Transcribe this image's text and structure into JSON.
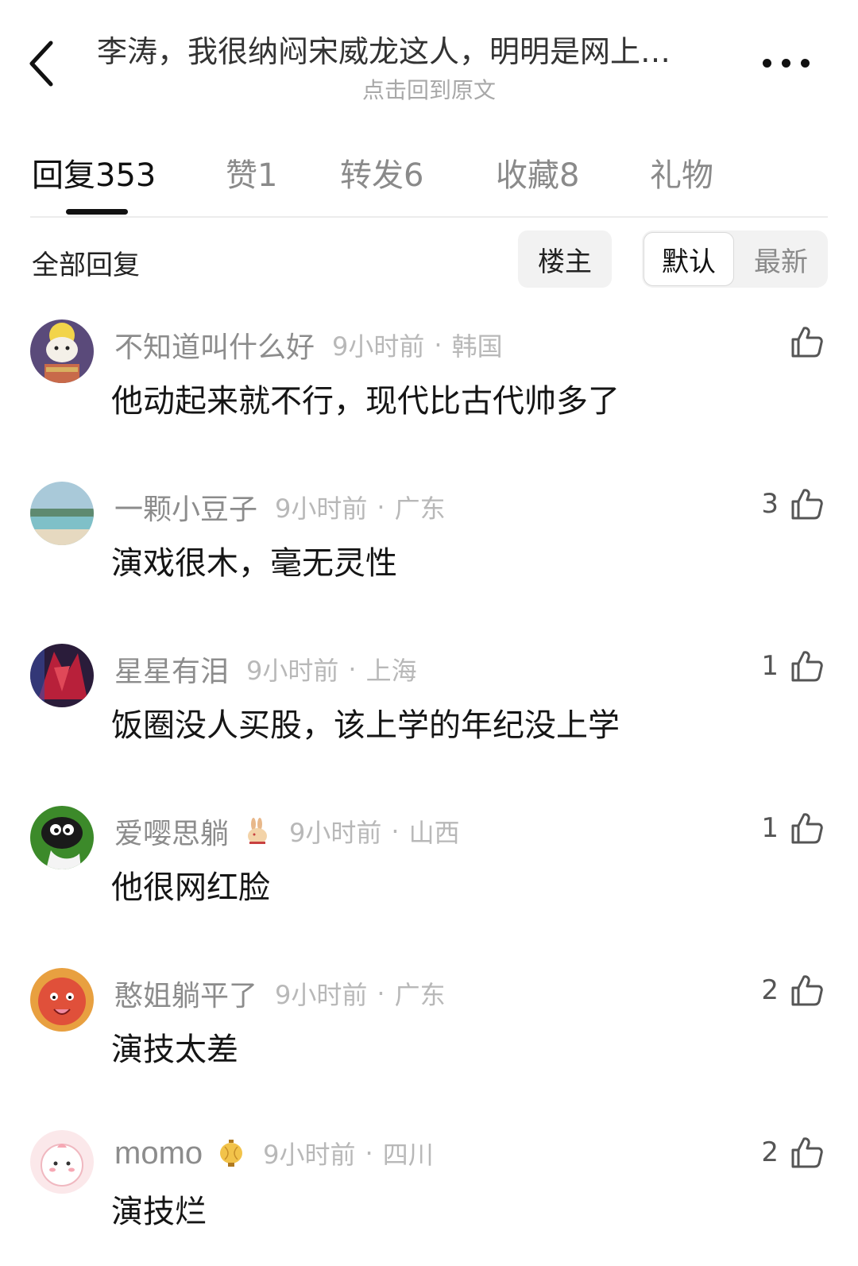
{
  "header": {
    "title": "李涛，我很纳闷宋威龙这人，明明是网上…",
    "subtitle": "点击回到原文",
    "icons": {
      "back": "chevron-left-icon",
      "more": "more-dots-icon"
    }
  },
  "tabs": [
    {
      "label": "回复353",
      "active": true
    },
    {
      "label": "赞1",
      "active": false
    },
    {
      "label": "转发6",
      "active": false
    },
    {
      "label": "收藏8",
      "active": false
    },
    {
      "label": "礼物",
      "active": false
    }
  ],
  "filter": {
    "all_label": "全部回复",
    "op_label": "楼主",
    "sort_default": "默认",
    "sort_latest": "最新",
    "sort_selected": "默认"
  },
  "comments": [
    {
      "user": "不知道叫什么好",
      "badge": "",
      "time": "9小时前",
      "location": "韩国",
      "text": "他动起来就不行，现代比古代帅多了",
      "likes": ""
    },
    {
      "user": "一颗小豆子",
      "badge": "",
      "time": "9小时前",
      "location": "广东",
      "text": "演戏很木，毫无灵性",
      "likes": "3"
    },
    {
      "user": "星星有泪",
      "badge": "",
      "time": "9小时前",
      "location": "上海",
      "text": "饭圈没人买股，该上学的年纪没上学",
      "likes": "1"
    },
    {
      "user": "爱嘤思躺",
      "badge": "rabbit-badge-icon",
      "time": "9小时前",
      "location": "山西",
      "text": "他很网红脸",
      "likes": "1"
    },
    {
      "user": "憨姐躺平了",
      "badge": "",
      "time": "9小时前",
      "location": "广东",
      "text": "演技太差",
      "likes": "2"
    },
    {
      "user": "momo",
      "badge": "lantern-badge-icon",
      "time": "9小时前",
      "location": "四川",
      "text": "演技烂",
      "likes": "2"
    }
  ],
  "colors": {
    "text_primary": "#151515",
    "text_secondary": "#8c8c8c",
    "text_muted": "#b8b8b8",
    "pill_bg": "#f2f2f2"
  }
}
